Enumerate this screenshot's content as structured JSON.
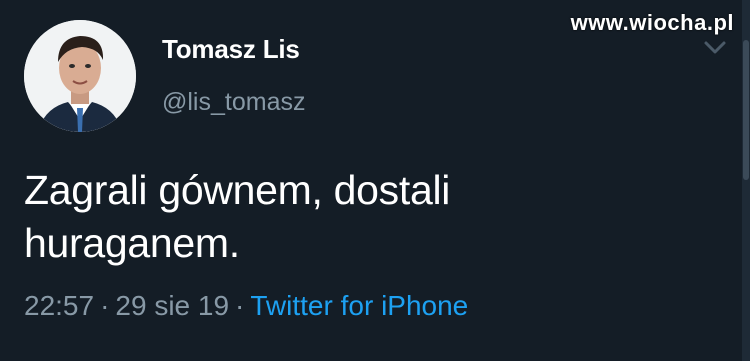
{
  "watermark": "www.wiocha.pl",
  "tweet": {
    "display_name": "Tomasz Lis",
    "handle": "@lis_tomasz",
    "text_line1": "Zagrali gównem, dostali",
    "text_line2": "huraganem.",
    "time": "22:57",
    "date": "29 sie 19",
    "source": "Twitter for iPhone",
    "separator": "·"
  },
  "icons": {
    "menu": "chevron-down-icon",
    "avatar": "profile-photo"
  },
  "colors": {
    "background": "#141d26",
    "muted_text": "#8899a6",
    "link": "#1da1f2",
    "text": "#ffffff"
  }
}
